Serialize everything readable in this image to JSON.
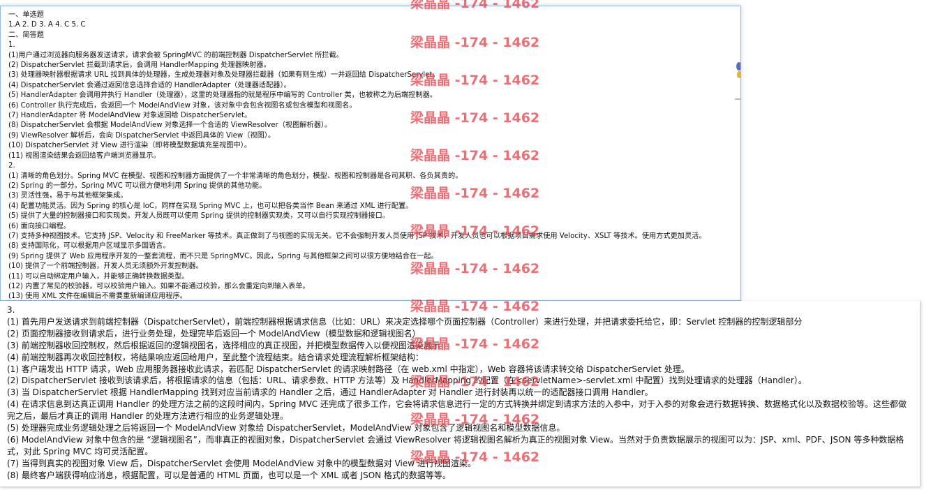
{
  "top": {
    "lines": [
      "一、单选题",
      "1.A 2. D 3. A 4. C 5. C",
      "二、简答题",
      "1.",
      "(1)用户通过浏览器向服务器发送请求，请求会被 SpringMVC 的前端控制器 DispatcherServlet 所拦截。",
      "(2) DispatcherServlet 拦截到请求后，会调用 HandlerMapping 处理器映射器。",
      "(3) 处理器映射器根据请求 URL 找到具体的处理器，生成处理器对象及处理器拦截器（如果有则生成）一并返回给 DispatcherServlet。",
      "(4) DispatcherServlet 会通过返回信息选择合适的 HandlerAdapter（处理器适配器）。",
      "(5) HandlerAdapter 会调用并执行 Handler（处理器），这里的处理器指的就是程序中编写的 Controller 类，也被称之为后端控制器。",
      "(6) Controller 执行完成后，会返回一个 ModelAndView 对象，该对象中会包含视图名或包含模型和视图名。",
      "(7) HandlerAdapter 将 ModelAndView 对象返回给 DispatcherServlet。",
      "(8) DispatcherServlet 会根据 ModelAndView 对象选择一个合适的 ViewResolver（视图解析器）。",
      "(9) ViewResolver 解析后，会向 DispatcherServlet 中返回具体的 View（视图）。",
      "(10) DispatcherServlet 对 View 进行渲染（即将模型数据填充至视图中）。",
      "(11) 视图渲染结果会返回给客户端浏览器显示。",
      "2.",
      "(1) 清晰的角色划分。Spring MVC 在模型、视图和控制器方面提供了一个非常清晰的角色划分，模型、视图和控制器是各司其职、各负其责的。",
      "(2) Spring 的一部分。Spring MVC 可以很方便地利用 Spring 提供的其他功能。",
      "(3) 灵活性强，易于与其他框架集成。",
      "(4) 配置功能灵活。因为 Spring 的核心是 IoC，同样在实现 Spring MVC 上，也可以把各类当作 Bean 来通过 XML 进行配置。",
      "(5) 提供了大量的控制器接口和实现类。开发人员既可以使用 Spring 提供的控制器实现类，又可以自行实现控制器接口。",
      "(6) 面向接口编程。",
      "(7) 支持多种视图技术。它支持 JSP、Velocity 和 FreeMarker 等技术。真正做到了与视图的实现无关。它不会强制开发人员使用 JSP 技术，开发人员也可以根据项目需求使用 Velocity、XSLT 等技术。使用方式更加灵活。",
      "(8) 支持国际化，可以根据用户区域显示多国语言。",
      "(9) Spring 提供了 Web 应用程序开发的一整套流程，而不只是 SpringMVC。因此，Spring 与其他框架之间可以很方便地结合在一起。",
      "(10) 提供了一个前端控制器，开发人员无须额外开发控制器。",
      "(11) 可以自动绑定用户输入，并能够正确转换数据类型。",
      "(12) 内置了常见的校验器，可以校验用户输入。如果不能通过校验，那么会重定向到输入表单。",
      "(13) 使用 XML 文件在编辑后不需要重新编译应用程序。"
    ]
  },
  "bottom": {
    "lines": [
      "3.",
      "(1) 首先用户发送请求到前端控制器（DispatcherServlet），前端控制器根据请求信息（比如：URL）来决定选择哪个页面控制器（Controller）来进行处理，并把请求委托给它，即：Servlet 控制器的控制逻辑部分",
      "(2) 页面控制器接收到请求后，进行业务处理，处理完毕后返回一个 ModelAndView（模型数据和逻辑视图名）",
      "(3) 前端控制器收回控制权，然后根据返回的逻辑视图名，选择相应的真正视图，并把模型数据传入以便视图渲染展示",
      "(4) 前端控制器再次收回控制权，将结果响应返回给用户，至此整个流程结束。结合请求处理流程解析框架结构：",
      "(1) 客户端发出 HTTP 请求，Web 应用服务器接收此请求，若匹配 DispatcherServlet 的请求映射路径（在 web.xml 中指定），Web 容器将该请求转交给 DispatcherServlet 处理。",
      "(2) DispatcherServlet 接收到该请求后，将根据请求的信息（包括：URL、请求参数、HTTP 方法等）及 HandlerMapping 的配置（在<servletName>-servlet.xml 中配置）找到处理请求的处理器（Handler）。",
      "(3) 当 DispatcherServlet 根据 HandlerMapping 找到对应当前请求的 Handler 之后，通过 HandlerAdapter 对 Handler 进行封装再以统一的适配器接口调用 Handler。",
      "(4) 在请求信息到达真正调用 Handler 的处理方法之前的这段时间内，Spring MVC 还完成了很多工作，它会将请求信息进行一定的方式转换并绑定到请求方法的入参中，对于入参的对象会进行数据转换、数据格式化以及数据校验等。这些都做完之后，最后才真正的调用 Handler 的处理方法进行相应的业务逻辑处理。",
      "(5) 处理器完成业务逻辑处理之后将返回一个 ModelAndView 对象给 DispatcherServlet，ModelAndView 对象包含了逻辑视图名和模型数据信息。",
      "(6) ModelAndView 对象中包含的是 “逻辑视图名”，而非真正的视图对象，DispatcherServlet 会通过 ViewResolver 将逻辑视图名解析为真正的视图对象 View。当然对于负责数据展示的视图可以为：JSP、xml、PDF、JSON 等多种数据格式，对此 Spring MVC 均可灵活配置。",
      "(7) 当得到真实的视图对象 View 后，DispatcherServlet 会使用 ModelAndView 对象中的模型数据对 View 进行视图渲染。",
      "(8) 最终客户端获得响应消息，根据配置，可以是普通的 HTML 页面，也可以是一个 XML 或者 JSON 格式的数据等等。"
    ]
  },
  "watermark": {
    "text": "梁晶晶 -174 - 1462",
    "color": "#e84650"
  }
}
